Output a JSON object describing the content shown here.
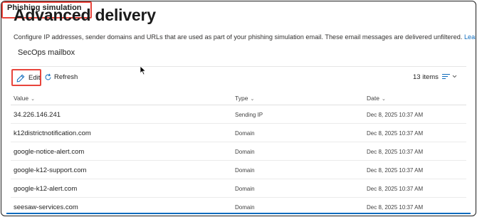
{
  "page": {
    "title": "Advanced delivery",
    "description": "Configure IP addresses, sender domains and URLs that are used as part of your phishing simulation email. These email messages are delivered unfiltered.",
    "learn_more": "Learn more"
  },
  "tabs": [
    {
      "label": "SecOps mailbox",
      "selected": false
    },
    {
      "label": "Phishing simulation",
      "selected": true
    }
  ],
  "toolbar": {
    "edit_label": "Edit",
    "refresh_label": "Refresh",
    "item_count": "13 items"
  },
  "table": {
    "columns": [
      "Value",
      "Type",
      "Date"
    ],
    "rows": [
      {
        "value": "34.226.146.241",
        "type": "Sending IP",
        "date": "Dec 8, 2025 10:37 AM"
      },
      {
        "value": "k12districtnotification.com",
        "type": "Domain",
        "date": "Dec 8, 2025 10:37 AM"
      },
      {
        "value": "google-notice-alert.com",
        "type": "Domain",
        "date": "Dec 8, 2025 10:37 AM"
      },
      {
        "value": "google-k12-support.com",
        "type": "Domain",
        "date": "Dec 8, 2025 10:37 AM"
      },
      {
        "value": "google-k12-alert.com",
        "type": "Domain",
        "date": "Dec 8, 2025 10:37 AM"
      },
      {
        "value": "seesaw-services.com",
        "type": "Domain",
        "date": "Dec 8, 2025 10:37 AM"
      }
    ]
  },
  "colors": {
    "accent": "#0f6cbd",
    "highlight": "#e8453c"
  }
}
